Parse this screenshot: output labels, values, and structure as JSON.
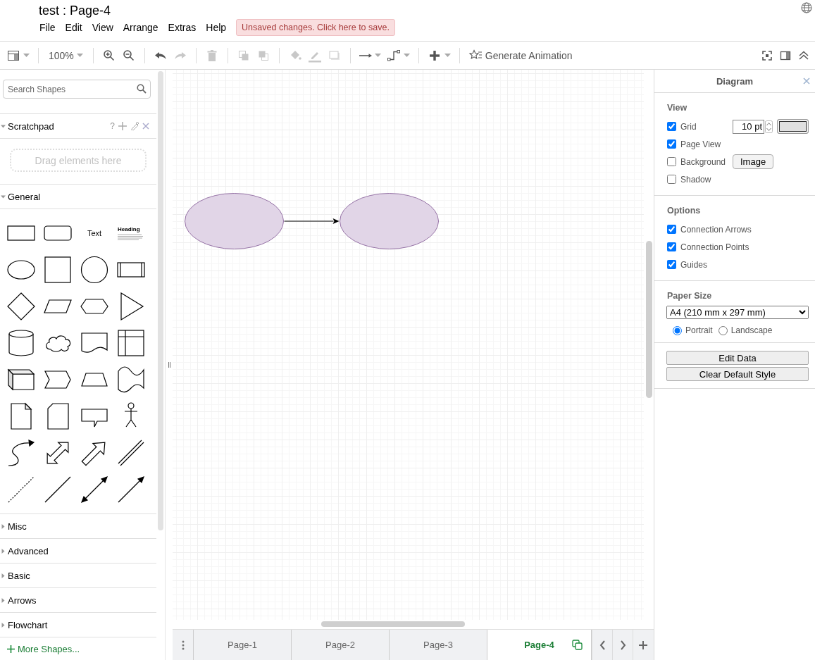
{
  "header": {
    "title": "test : Page-4",
    "menu": [
      "File",
      "Edit",
      "View",
      "Arrange",
      "Extras",
      "Help"
    ],
    "save_notice": "Unsaved changes. Click here to save."
  },
  "toolbar": {
    "groups": [
      [
        {
          "kind": "format",
          "disabled": false,
          "dropdown": true
        }
      ],
      [
        {
          "kind": "zoom",
          "label": "100%",
          "disabled": false,
          "dropdown": true
        }
      ],
      [
        {
          "kind": "zoom_in",
          "disabled": false,
          "dropdown": false
        },
        {
          "kind": "zoom_out",
          "disabled": false,
          "dropdown": false
        }
      ],
      [
        {
          "kind": "undo",
          "disabled": false,
          "dropdown": false
        },
        {
          "kind": "redo",
          "disabled": true,
          "dropdown": false
        }
      ],
      [
        {
          "kind": "delete",
          "disabled": true,
          "dropdown": false
        }
      ],
      [
        {
          "kind": "to_front",
          "disabled": true,
          "dropdown": false
        },
        {
          "kind": "to_back",
          "disabled": true,
          "dropdown": false
        }
      ],
      [
        {
          "kind": "fill",
          "disabled": true,
          "dropdown": false
        },
        {
          "kind": "line_color",
          "disabled": true,
          "dropdown": false
        },
        {
          "kind": "shadow",
          "disabled": true,
          "dropdown": false
        }
      ],
      [
        {
          "kind": "connection",
          "disabled": false,
          "dropdown": true
        },
        {
          "kind": "waypoints",
          "disabled": false,
          "dropdown": true
        }
      ],
      [
        {
          "kind": "insert",
          "disabled": false,
          "dropdown": true
        }
      ],
      [
        {
          "kind": "animation",
          "label": "Generate Animation",
          "disabled": false,
          "dropdown": false
        }
      ]
    ],
    "right": [
      {
        "kind": "fullscreen"
      },
      {
        "kind": "panel"
      },
      {
        "kind": "collapse"
      }
    ]
  },
  "sidebar": {
    "search": {
      "placeholder": "Search Shapes"
    },
    "sections": [
      {
        "title": "Scratchpad",
        "expanded": true,
        "kind": "scratchpad",
        "help": "?",
        "drop_hint": "Drag elements here"
      },
      {
        "title": "General",
        "expanded": true,
        "kind": "shapes",
        "shapes": [
          {
            "kind": "rect"
          },
          {
            "kind": "rounded"
          },
          {
            "kind": "text",
            "label": "Text"
          },
          {
            "kind": "heading",
            "label": "Heading"
          },
          {
            "kind": "ellipse"
          },
          {
            "kind": "square"
          },
          {
            "kind": "circle"
          },
          {
            "kind": "process"
          },
          {
            "kind": "diamond"
          },
          {
            "kind": "parallelogram"
          },
          {
            "kind": "hexagon"
          },
          {
            "kind": "triangle"
          },
          {
            "kind": "cylinder"
          },
          {
            "kind": "cloud"
          },
          {
            "kind": "document"
          },
          {
            "kind": "storage"
          },
          {
            "kind": "cube"
          },
          {
            "kind": "step"
          },
          {
            "kind": "trapezoid"
          },
          {
            "kind": "tape"
          },
          {
            "kind": "note"
          },
          {
            "kind": "card"
          },
          {
            "kind": "callout"
          },
          {
            "kind": "actor"
          },
          {
            "kind": "curved_arrow"
          },
          {
            "kind": "double_arrow"
          },
          {
            "kind": "thick_arrow"
          },
          {
            "kind": "link"
          },
          {
            "kind": "dashed_line"
          },
          {
            "kind": "line"
          },
          {
            "kind": "bidirectional"
          },
          {
            "kind": "directional"
          }
        ]
      },
      {
        "title": "Misc",
        "expanded": false,
        "kind": "shapes"
      },
      {
        "title": "Advanced",
        "expanded": false,
        "kind": "shapes"
      },
      {
        "title": "Basic",
        "expanded": false,
        "kind": "shapes"
      },
      {
        "title": "Arrows",
        "expanded": false,
        "kind": "shapes"
      },
      {
        "title": "Flowchart",
        "expanded": false,
        "kind": "shapes"
      }
    ],
    "more_shapes": "More Shapes..."
  },
  "canvas": {
    "nodes": [
      {
        "kind": "ellipse"
      },
      {
        "kind": "ellipse"
      }
    ],
    "edges": [
      {
        "kind": "arrow"
      }
    ]
  },
  "pages": [
    {
      "label": "Page-1",
      "selected": false
    },
    {
      "label": "Page-2",
      "selected": false
    },
    {
      "label": "Page-3",
      "selected": false
    },
    {
      "label": "Page-4",
      "selected": true
    }
  ],
  "format_panel": {
    "title": "Diagram",
    "view": {
      "title": "View",
      "grid": {
        "label": "Grid",
        "checked": true,
        "size": "10 pt"
      },
      "page_view": {
        "label": "Page View",
        "checked": true
      },
      "background": {
        "label": "Background",
        "checked": false,
        "button": "Image"
      },
      "shadow": {
        "label": "Shadow",
        "checked": false
      }
    },
    "options": {
      "title": "Options",
      "items": [
        {
          "label": "Connection Arrows",
          "checked": true
        },
        {
          "label": "Connection Points",
          "checked": true
        },
        {
          "label": "Guides",
          "checked": true
        }
      ]
    },
    "paper": {
      "title": "Paper Size",
      "size": "A4 (210 mm x 297 mm)",
      "orientations": [
        {
          "label": "Portrait",
          "selected": true
        },
        {
          "label": "Landscape",
          "selected": false
        }
      ]
    },
    "buttons": [
      "Edit Data",
      "Clear Default Style"
    ]
  }
}
